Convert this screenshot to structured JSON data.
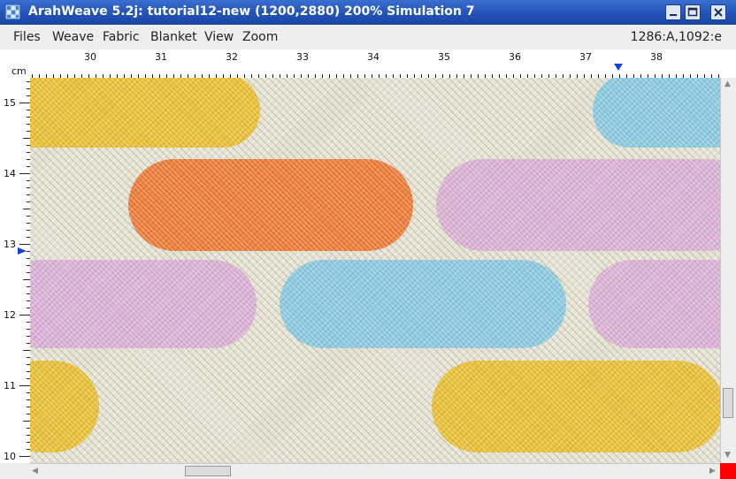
{
  "window": {
    "title": "ArahWeave 5.2j: tutorial12-new (1200,2880) 200% Simulation 7",
    "app_icon": "arahweave-grid-icon",
    "controls": [
      "minimize-icon",
      "maximize-icon",
      "close-icon"
    ]
  },
  "menu": {
    "items": [
      "Files",
      "Weave",
      "Fabric",
      "Blanket",
      "View",
      "Zoom"
    ],
    "status": "1286:A,1092:e"
  },
  "rulers": {
    "unit": "cm",
    "top_labels": [
      "30",
      "31",
      "32",
      "33",
      "34",
      "35",
      "36",
      "37",
      "38"
    ],
    "left_labels": [
      "15",
      "14",
      "13",
      "12",
      "11",
      "10"
    ],
    "top_marker_icon": "triangle-down-icon",
    "left_marker_icon": "triangle-right-icon"
  },
  "canvas": {
    "view_mode": "Simulation 7",
    "zoom": "200%",
    "colors": {
      "ground": "#e5e2d4",
      "yellow": "#eac13a",
      "orange": "#ee7e3c",
      "pink": "#dcb3d6",
      "blue": "#8ecbe0"
    }
  },
  "scroll": {
    "horizontal_position": 0.23,
    "vertical_position": 0.9
  },
  "corner": {
    "color": "#ff0000"
  }
}
